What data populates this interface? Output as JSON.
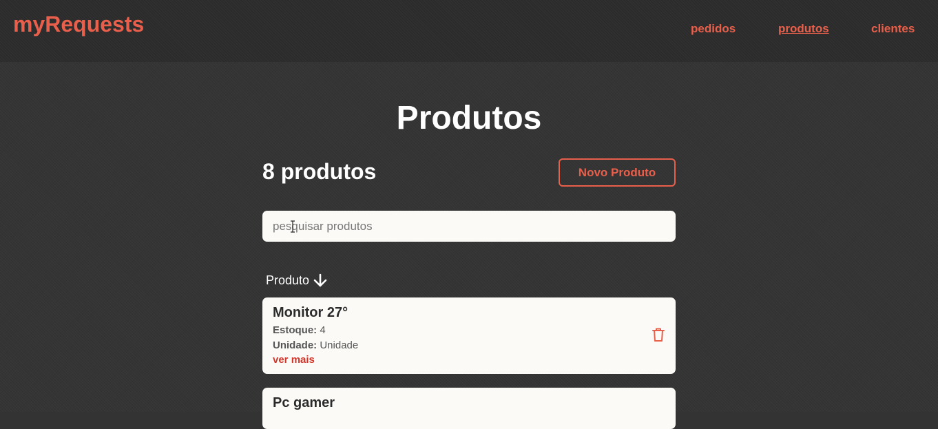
{
  "app": {
    "logo": "myRequests"
  },
  "nav": [
    {
      "label": "pedidos",
      "active": false
    },
    {
      "label": "produtos",
      "active": true
    },
    {
      "label": "clientes",
      "active": false
    }
  ],
  "page": {
    "title": "Produtos",
    "count_label": "8 produtos",
    "new_button": "Novo Produto"
  },
  "search": {
    "placeholder": "pesquisar produtos",
    "value": ""
  },
  "sort": {
    "label": "Produto",
    "icon": "arrow-down-icon"
  },
  "products": [
    {
      "name": "Monitor 27°",
      "stock_label": "Estoque:",
      "stock": "4",
      "unit_label": "Unidade:",
      "unit": "Unidade",
      "more": "ver mais",
      "delete_icon": "trash-icon"
    },
    {
      "name": "Pc gamer"
    }
  ],
  "colors": {
    "accent": "#e8604c",
    "danger": "#d2362b",
    "card": "#fbfaf7"
  }
}
